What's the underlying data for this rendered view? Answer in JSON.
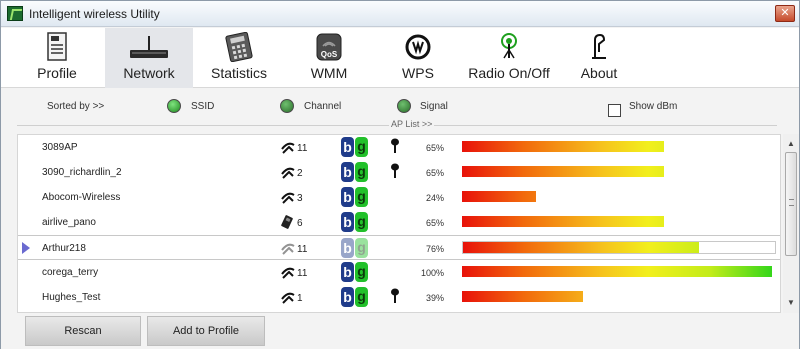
{
  "window": {
    "title": "Intelligent wireless Utility",
    "close_label": "✕"
  },
  "toolbar": {
    "items": [
      {
        "label": "Profile",
        "icon": "profile-icon"
      },
      {
        "label": "Network",
        "icon": "router-icon",
        "active": true
      },
      {
        "label": "Statistics",
        "icon": "calculator-icon"
      },
      {
        "label": "WMM",
        "icon": "qos-icon",
        "badge": "QoS"
      },
      {
        "label": "WPS",
        "icon": "wps-icon"
      },
      {
        "label": "Radio On/Off",
        "icon": "radio-antenna-icon"
      },
      {
        "label": "About",
        "icon": "about-icon"
      }
    ]
  },
  "sort": {
    "label": "Sorted by >>",
    "options": [
      {
        "label": "SSID",
        "selected": true
      },
      {
        "label": "Channel",
        "selected": false
      },
      {
        "label": "Signal",
        "selected": false
      }
    ],
    "show_dbm_label": "Show dBm",
    "show_dbm_checked": false
  },
  "ap_list": {
    "title": "AP List >>",
    "rows": [
      {
        "ssid": "3089AP",
        "channel": "11",
        "modes": "bg",
        "secured": true,
        "signal": "65%",
        "signal_value": 65,
        "type": "infrastructure"
      },
      {
        "ssid": "3090_richardlin_2",
        "channel": "2",
        "modes": "bg",
        "secured": true,
        "signal": "65%",
        "signal_value": 65,
        "type": "infrastructure"
      },
      {
        "ssid": "Abocom-Wireless",
        "channel": "3",
        "modes": "bg",
        "secured": false,
        "signal": "24%",
        "signal_value": 24,
        "type": "infrastructure"
      },
      {
        "ssid": "airlive_pano",
        "channel": "6",
        "modes": "bg",
        "secured": false,
        "signal": "65%",
        "signal_value": 65,
        "type": "adhoc"
      },
      {
        "ssid": "Arthur218",
        "channel": "11",
        "modes": "bg",
        "secured": false,
        "signal": "76%",
        "signal_value": 76,
        "type": "infrastructure",
        "selected": true
      },
      {
        "ssid": "corega_terry",
        "channel": "11",
        "modes": "bg",
        "secured": false,
        "signal": "100%",
        "signal_value": 100,
        "type": "infrastructure"
      },
      {
        "ssid": "Hughes_Test",
        "channel": "1",
        "modes": "bg",
        "secured": true,
        "signal": "39%",
        "signal_value": 39,
        "type": "infrastructure"
      }
    ]
  },
  "buttons": {
    "rescan": "Rescan",
    "add_to_profile": "Add to Profile"
  },
  "colors": {
    "signal_low": "#e8120a",
    "signal_mid": "#f2ef1c",
    "signal_high": "#34d61a",
    "mode_b": "#1f3b8a",
    "mode_g": "#22c02a"
  }
}
